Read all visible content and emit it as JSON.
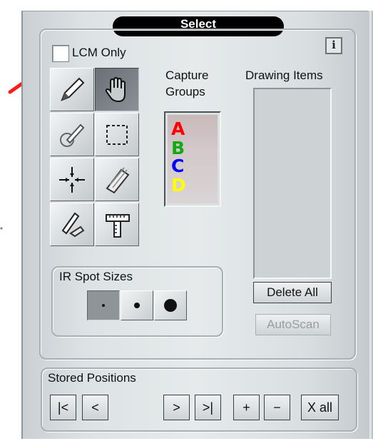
{
  "panel": {
    "title": "Select",
    "info_label": "i",
    "lcm_only_label": "LCM Only",
    "lcm_only_checked": false
  },
  "tools": [
    {
      "name": "pen-icon",
      "active": false
    },
    {
      "name": "hand-icon",
      "active": true
    },
    {
      "name": "brush-circle-icon",
      "active": false
    },
    {
      "name": "rectangle-select-icon",
      "active": false
    },
    {
      "name": "crosshair-icon",
      "active": false
    },
    {
      "name": "eraser-icon",
      "active": false
    },
    {
      "name": "pen-erase-icon",
      "active": false
    },
    {
      "name": "ruler-icon",
      "active": false
    }
  ],
  "capture_groups": {
    "label_line1": "Capture",
    "label_line2": "Groups",
    "items": [
      {
        "letter": "A",
        "color": "#ff0000"
      },
      {
        "letter": "B",
        "color": "#11aa11"
      },
      {
        "letter": "C",
        "color": "#0000ff"
      },
      {
        "letter": "D",
        "color": "#ffff00"
      }
    ]
  },
  "drawing_items": {
    "label": "Drawing Items",
    "delete_all_label": "Delete All",
    "autoscan_label": "AutoScan"
  },
  "ir_spot_sizes": {
    "label": "IR Spot Sizes",
    "sizes": [
      "small",
      "medium",
      "large"
    ],
    "selected": "small"
  },
  "stored_positions": {
    "label": "Stored Positions",
    "first_label": "|<",
    "prev_label": "<",
    "next_label": ">",
    "last_label": ">|",
    "add_label": "+",
    "remove_label": "−",
    "clear_all_label": "X all"
  },
  "annotation": {
    "arrow_color": "#ff1a1a"
  }
}
